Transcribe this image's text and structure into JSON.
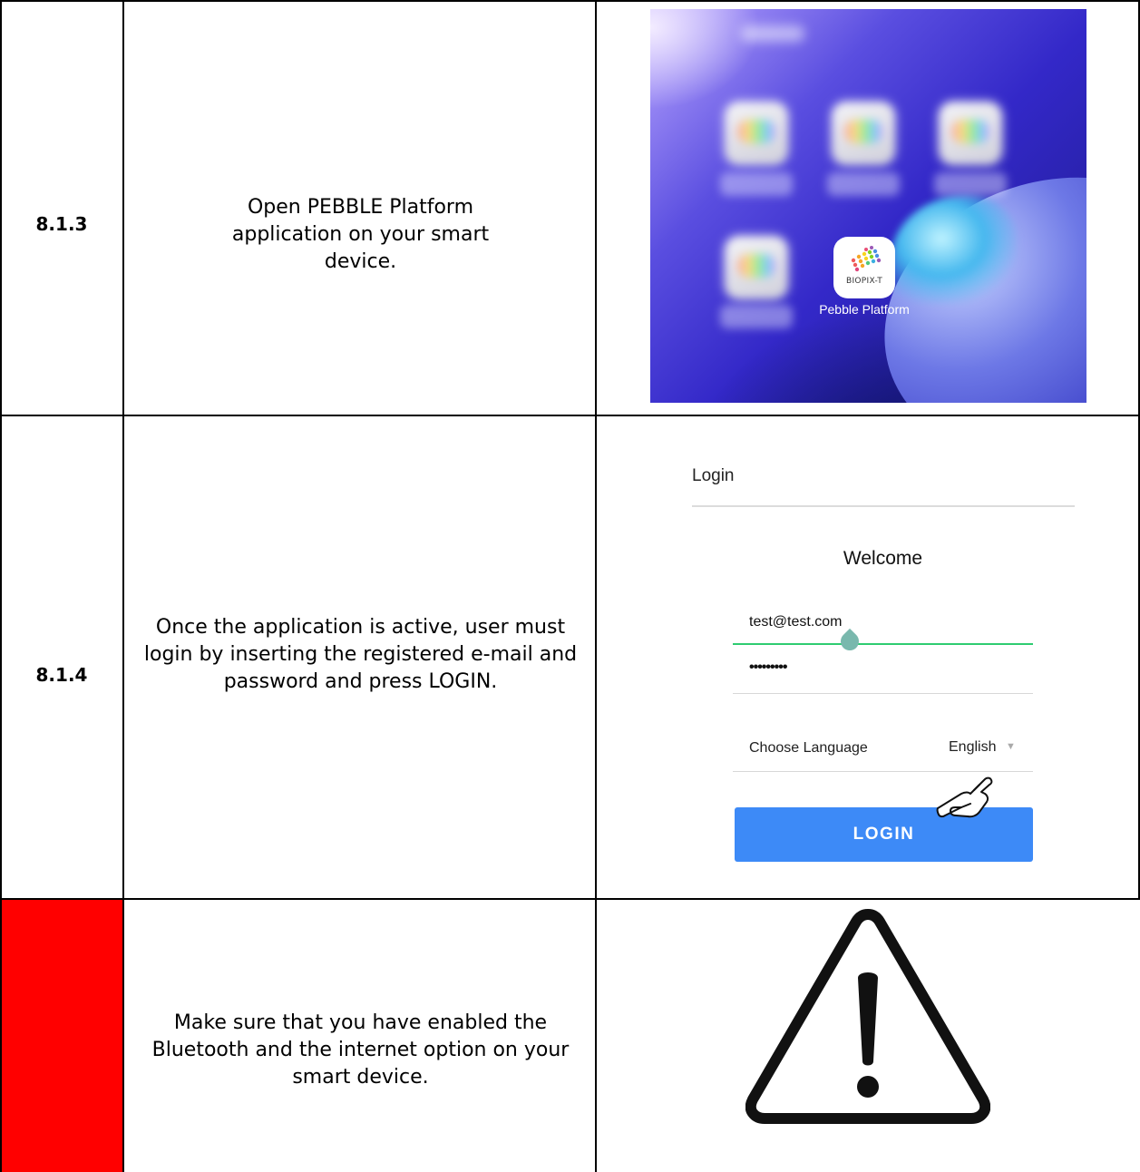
{
  "rows": [
    {
      "step": "8.1.3",
      "text": "Open PEBBLE Platform application on your smart device.",
      "screenshot": {
        "app_icon_text": "BIOPIX-T",
        "app_label": "Pebble Platform"
      }
    },
    {
      "step": "8.1.4",
      "text": "Once the application is active, user must login by inserting the registered e-mail and password and press LOGIN.",
      "screenshot": {
        "title": "Login",
        "welcome": "Welcome",
        "email_value": "test@test.com",
        "password_value": "•••••••••",
        "language_label": "Choose Language",
        "language_value": "English",
        "login_button": "LOGIN"
      }
    },
    {
      "step": "",
      "step_cell_color": "#ff0000",
      "text": "Make sure that you have enabled the Bluetooth and the internet option on your smart device.",
      "icon": "warning-triangle-icon"
    }
  ],
  "colors": {
    "login_button": "#3d8af7",
    "active_field_line": "#2ecc71",
    "warning_cell": "#ff0000"
  }
}
